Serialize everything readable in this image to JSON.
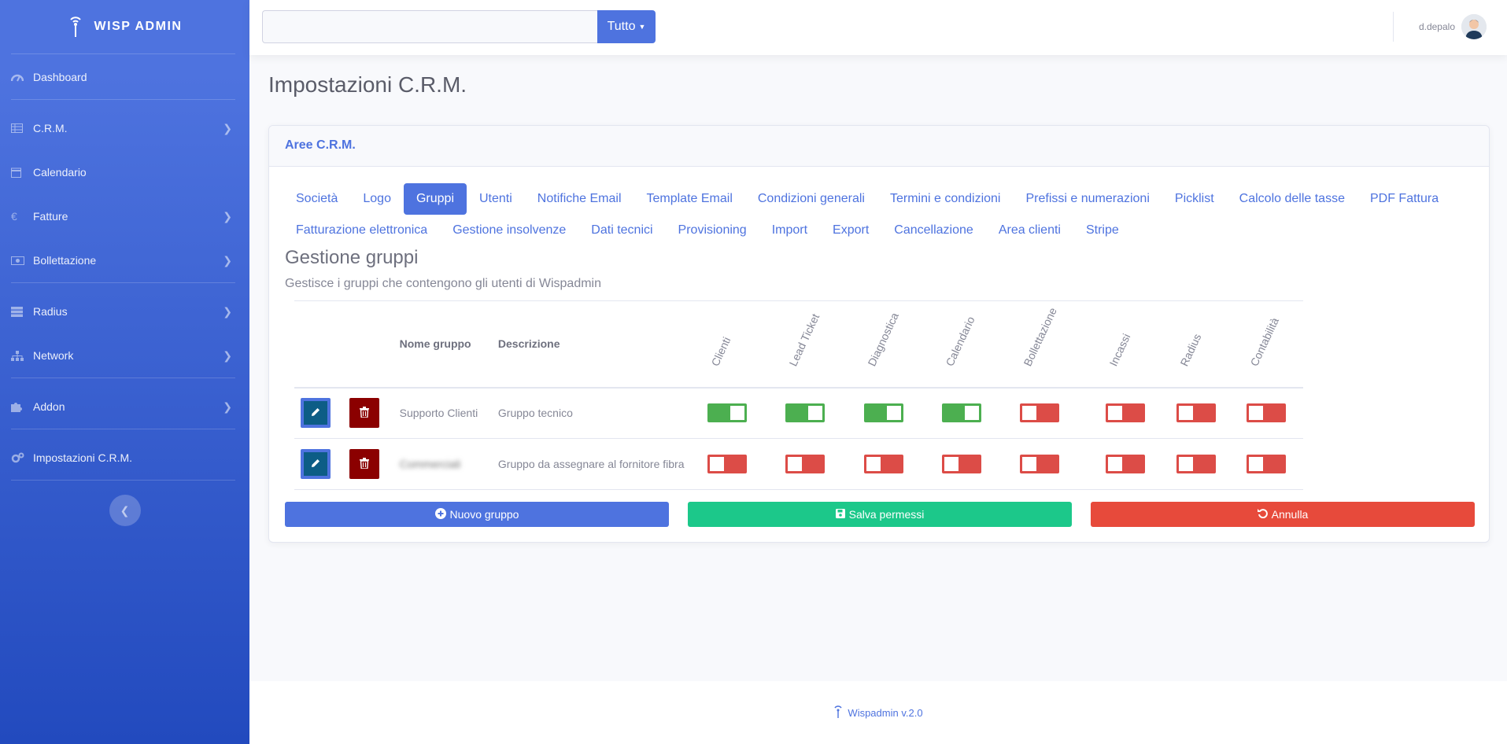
{
  "brand": {
    "title": "WISP ADMIN"
  },
  "sidebar": {
    "items": [
      {
        "label": "Dashboard",
        "icon": "dashboard-icon",
        "chevron": false
      },
      {
        "label": "C.R.M.",
        "icon": "table-icon",
        "chevron": true
      },
      {
        "label": "Calendario",
        "icon": "calendar-icon",
        "chevron": false
      },
      {
        "label": "Fatture",
        "icon": "euro-icon",
        "chevron": true
      },
      {
        "label": "Bollettazione",
        "icon": "money-bill-icon",
        "chevron": true
      },
      {
        "label": "Radius",
        "icon": "server-icon",
        "chevron": true
      },
      {
        "label": "Network",
        "icon": "sitemap-icon",
        "chevron": true
      },
      {
        "label": "Addon",
        "icon": "puzzle-icon",
        "chevron": true
      },
      {
        "label": "Impostazioni C.R.M.",
        "icon": "cogs-icon",
        "chevron": false
      }
    ]
  },
  "topbar": {
    "search_value": "",
    "search_button": "Tutto",
    "username": "d.depalo"
  },
  "page": {
    "title": "Impostazioni C.R.M."
  },
  "card": {
    "header": "Aree C.R.M.",
    "tabs": [
      "Società",
      "Logo",
      "Gruppi",
      "Utenti",
      "Notifiche Email",
      "Template Email",
      "Condizioni generali",
      "Termini e condizioni",
      "Prefissi e numerazioni",
      "Picklist",
      "Calcolo delle tasse",
      "PDF Fattura",
      "Fatturazione elettronica",
      "Gestione insolvenze",
      "Dati tecnici",
      "Provisioning",
      "Import",
      "Export",
      "Cancellazione",
      "Area clienti",
      "Stripe"
    ],
    "active_tab": "Gruppi",
    "section_title": "Gestione gruppi",
    "section_subtitle": "Gestisce i gruppi che contengono gli utenti di Wispadmin"
  },
  "table": {
    "col_name": "Nome gruppo",
    "col_desc": "Descrizione",
    "permission_columns": [
      "Clienti",
      "Lead Ticket",
      "Diagnostica",
      "Calendario",
      "Bollettazione",
      "Incassi",
      "Radius",
      "Contabilità"
    ],
    "rows": [
      {
        "name": "Supporto Clienti",
        "description": "Gruppo tecnico",
        "permissions": [
          true,
          true,
          true,
          true,
          false,
          false,
          false,
          false
        ]
      },
      {
        "name": "Commerciali",
        "description": "Gruppo da assegnare al fornitore fibra",
        "permissions": [
          false,
          false,
          false,
          false,
          false,
          false,
          false,
          false
        ]
      }
    ]
  },
  "actions": {
    "new_group": "Nuovo gruppo",
    "save": "Salva permessi",
    "cancel": "Annulla"
  },
  "footer": {
    "text": "Wispadmin v.2.0"
  },
  "colors": {
    "primary": "#4e73df",
    "success": "#1cc88a",
    "danger": "#e74a3b",
    "switch_on": "#4caf50",
    "switch_off": "#dc4c47"
  }
}
